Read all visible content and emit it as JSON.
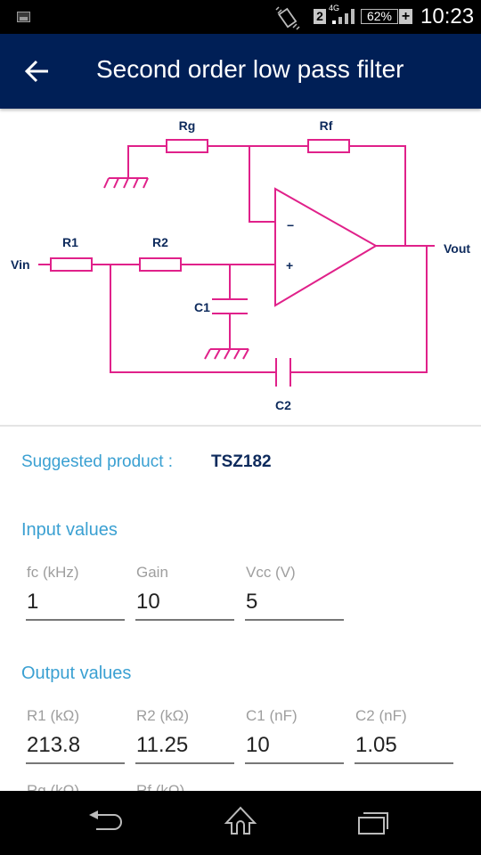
{
  "status_bar": {
    "sim_slot": "2",
    "network_type": "4G",
    "battery": "62%",
    "charging_icon": "plus-icon",
    "time": "10:23",
    "icons": [
      "gallery-icon",
      "vibrate-icon",
      "signal-icon",
      "battery-icon"
    ]
  },
  "app_bar": {
    "back_icon": "arrow-left-icon",
    "title": "Second order low pass filter"
  },
  "schematic": {
    "labels": {
      "rg": "Rg",
      "rf": "Rf",
      "r1": "R1",
      "r2": "R2",
      "c1": "C1",
      "c2": "C2",
      "vin": "Vin",
      "vout": "Vout",
      "minus": "−",
      "plus": "+"
    },
    "line_color": "#e0218a"
  },
  "suggested": {
    "label": "Suggested product :",
    "value": "TSZ182"
  },
  "input_values": {
    "title": "Input values",
    "fields": [
      {
        "label": "fc (kHz)",
        "value": "1"
      },
      {
        "label": "Gain",
        "value": "10"
      },
      {
        "label": "Vcc (V)",
        "value": "5"
      }
    ]
  },
  "output_values": {
    "title": "Output values",
    "fields": [
      {
        "label": "R1 (kΩ)",
        "value": "213.8"
      },
      {
        "label": "R2 (kΩ)",
        "value": "11.25"
      },
      {
        "label": "C1 (nF)",
        "value": "10"
      },
      {
        "label": "C2 (nF)",
        "value": "1.05"
      }
    ],
    "partial_fields": [
      {
        "label": "Rg (kΩ)"
      },
      {
        "label": "Rf (kΩ)"
      }
    ]
  },
  "nav_bar": {
    "buttons": [
      "back-icon",
      "home-icon",
      "recents-icon"
    ]
  },
  "colors": {
    "app_bar": "#001f56",
    "accent": "#3aa0d2",
    "product": "#0d2a5c",
    "schematic_lines": "#e0218a"
  }
}
